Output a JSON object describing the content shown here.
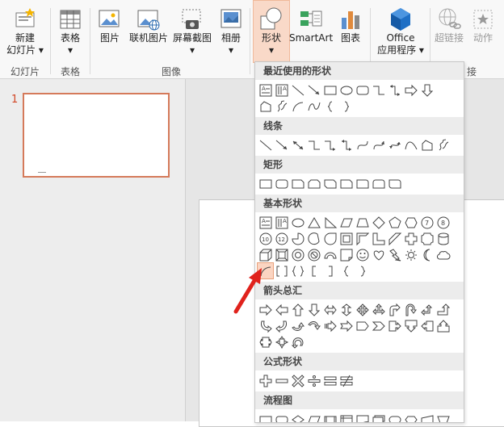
{
  "ribbon": {
    "buttons": [
      {
        "id": "new-slide",
        "line1": "新建",
        "line2": "幻灯片 ▾",
        "disabled": false
      },
      {
        "id": "table",
        "line1": "表格",
        "line2": "▾",
        "disabled": false
      },
      {
        "id": "picture",
        "line1": "图片",
        "line2": "",
        "disabled": false
      },
      {
        "id": "online-picture",
        "line1": "联机图片",
        "line2": "",
        "disabled": false
      },
      {
        "id": "screenshot",
        "line1": "屏幕截图",
        "line2": "▾",
        "disabled": false
      },
      {
        "id": "album",
        "line1": "相册",
        "line2": "▾",
        "disabled": false
      },
      {
        "id": "shapes",
        "line1": "形状",
        "line2": "▾",
        "disabled": false
      },
      {
        "id": "smartart",
        "line1": "SmartArt",
        "line2": "",
        "disabled": false
      },
      {
        "id": "chart",
        "line1": "图表",
        "line2": "",
        "disabled": false
      },
      {
        "id": "office-apps",
        "line1": "Office",
        "line2": "应用程序 ▾",
        "disabled": false
      },
      {
        "id": "hyperlink",
        "line1": "超链接",
        "line2": "",
        "disabled": true
      },
      {
        "id": "action",
        "line1": "动作",
        "line2": "",
        "disabled": true
      }
    ],
    "groups": [
      "幻灯片",
      "表格",
      "图像",
      "接"
    ]
  },
  "thumbnail": {
    "number": "1"
  },
  "shapes_menu": {
    "sections": [
      {
        "title": "最近使用的形状",
        "rows": [
          [
            "textbox",
            "vtextbox",
            "line",
            "arrow",
            "rect",
            "ellipse",
            "rrect",
            "elbow",
            "elbow2",
            "rarrow",
            "darrow"
          ],
          [
            "freeform",
            "scribble",
            "arc",
            "curly",
            "lbrace",
            "rbrace"
          ]
        ]
      },
      {
        "title": "线条",
        "rows": [
          [
            "line",
            "arrow",
            "dblarrow",
            "elbow",
            "elbow1",
            "elbow2",
            "curve",
            "curve1",
            "curve2",
            "arc2",
            "freeform",
            "scribble"
          ]
        ]
      },
      {
        "title": "矩形",
        "rows": [
          [
            "rect",
            "rrect",
            "snip1",
            "snip2",
            "snip3",
            "snipr",
            "rr1",
            "rr2",
            "rr3"
          ]
        ]
      },
      {
        "title": "基本形状",
        "rows": [
          [
            "textbox",
            "vtextbox",
            "ellipse",
            "triangle",
            "rtriangle",
            "parallelogram",
            "trapezoid",
            "diamond",
            "pentagon",
            "hexagon",
            "c7",
            "c8"
          ],
          [
            "c10",
            "c12",
            "pie",
            "chord",
            "teardrop",
            "frame",
            "halfframe",
            "lshape",
            "diagstripe",
            "cross",
            "plaque",
            "can"
          ],
          [
            "cube",
            "bevel",
            "donut",
            "noentry",
            "blockarc",
            "foldedcorner",
            "smiley",
            "heart",
            "lightning",
            "sun",
            "moon",
            "cloud"
          ],
          [
            "arc",
            "bracketpair",
            "bracepair",
            "lbracket",
            "rbracket",
            "lbrace",
            "rbrace"
          ]
        ]
      },
      {
        "title": "箭头总汇",
        "rows": [
          [
            "rarrow",
            "larrow",
            "uarrow",
            "darrow",
            "lrarrow",
            "udarrow",
            "quadarrow",
            "lruarrow",
            "bentarrow",
            "uturn",
            "lubent",
            "bentup"
          ],
          [
            "curvedr",
            "curvedl",
            "curvedu",
            "curvedd",
            "stripedr",
            "notchedr",
            "pentarrow",
            "chevron",
            "rcallout",
            "dcallout",
            "lcallout",
            "ucallout"
          ],
          [
            "lrcallout",
            "quadcallout",
            "circarrow"
          ]
        ]
      },
      {
        "title": "公式形状",
        "rows": [
          [
            "plus",
            "minus",
            "mult",
            "div",
            "equal",
            "notequal"
          ]
        ]
      },
      {
        "title": "流程图",
        "rows": [
          [
            "fprocess",
            "falt",
            "fdecision",
            "fdata",
            "fpredef",
            "finternal",
            "fdocument",
            "fmultidoc",
            "fterminator",
            "fprep",
            "fmanual",
            "fmanualop"
          ],
          [
            "fconn",
            "foffpage",
            "fcard",
            "ftape",
            "fsum",
            "for",
            "fcollate",
            "fsort",
            "fextract",
            "fmerge",
            "fstored",
            "fdelay"
          ]
        ]
      }
    ],
    "selected_shape": "arc"
  },
  "colors": {
    "accent": "#d24726",
    "annotation": "#e0221c",
    "active_bg": "#f9d9c8"
  }
}
